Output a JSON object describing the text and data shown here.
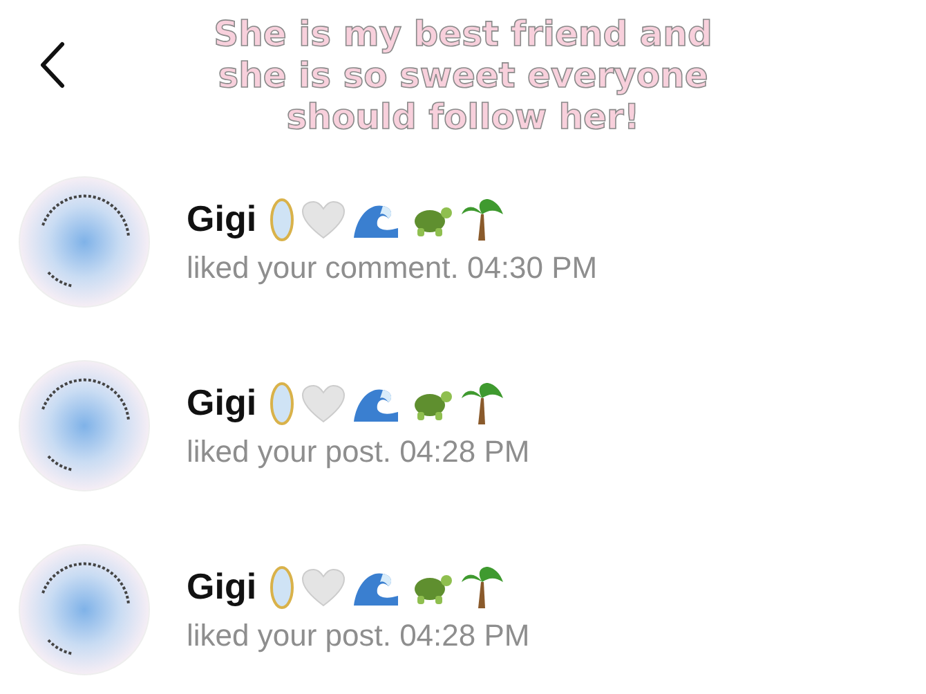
{
  "caption": "She is my best friend and\nshe is so sweet everyone\nshould follow her!",
  "notifications": [
    {
      "name": "Gigi",
      "text": "liked your comment. 04:30 PM"
    },
    {
      "name": "Gigi",
      "text": "liked your post. 04:28 PM"
    },
    {
      "name": "Gigi",
      "text": "liked your post. 04:28 PM"
    }
  ]
}
